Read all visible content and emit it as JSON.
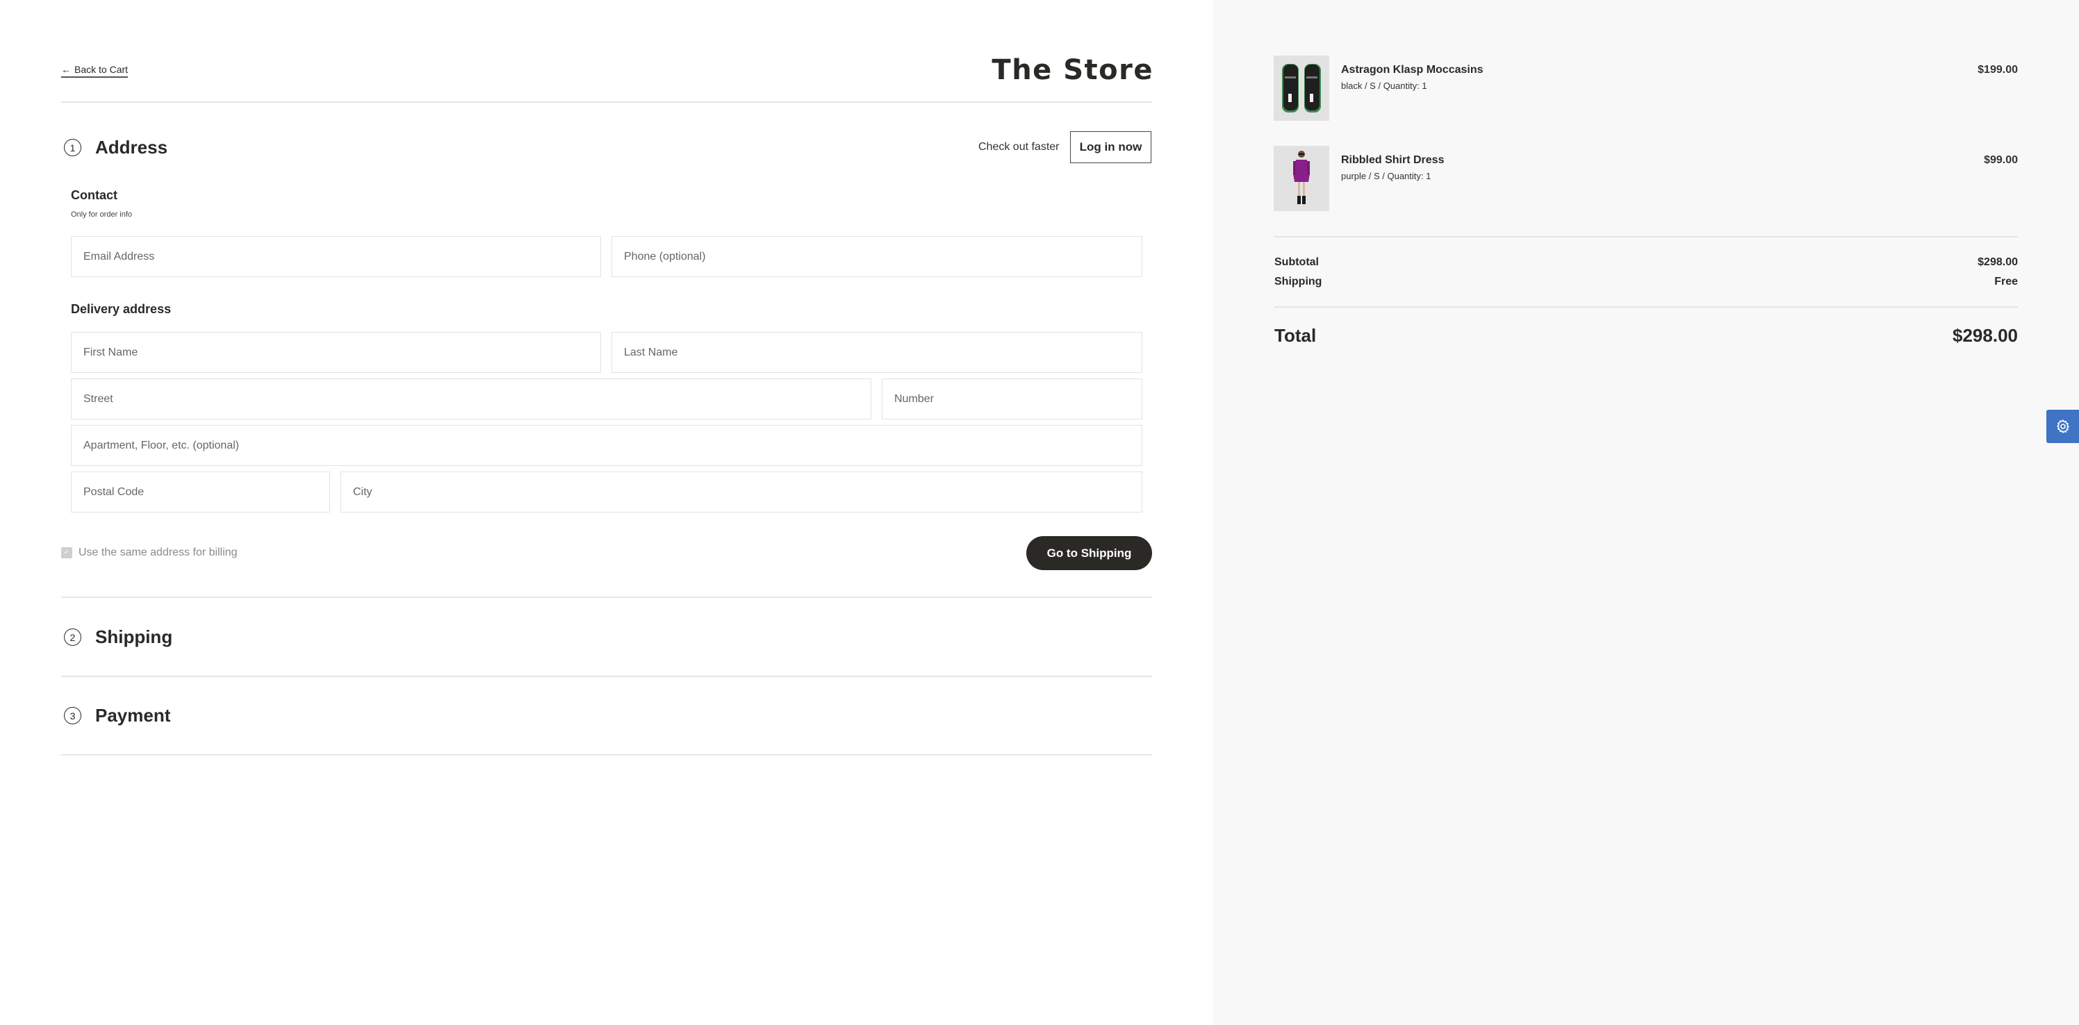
{
  "header": {
    "back_label": "Back to Cart",
    "back_icon": "arrow-left-icon",
    "store_title": "The Store"
  },
  "steps": [
    {
      "number": "1",
      "title": "Address"
    },
    {
      "number": "2",
      "title": "Shipping"
    },
    {
      "number": "3",
      "title": "Payment"
    }
  ],
  "login": {
    "prompt": "Check out faster",
    "button_label": "Log in now"
  },
  "contact": {
    "title": "Contact",
    "subtitle": "Only for order info",
    "email_placeholder": "Email Address",
    "email_value": "",
    "phone_placeholder": "Phone (optional)",
    "phone_value": ""
  },
  "delivery": {
    "title": "Delivery address",
    "first_name_placeholder": "First Name",
    "last_name_placeholder": "Last Name",
    "street_placeholder": "Street",
    "number_placeholder": "Number",
    "apartment_placeholder": "Apartment, Floor, etc. (optional)",
    "postal_placeholder": "Postal Code",
    "city_placeholder": "City"
  },
  "billing": {
    "label": "Use the same address for billing",
    "checked": true
  },
  "actions": {
    "go_to_shipping": "Go to Shipping"
  },
  "summary": {
    "items": [
      {
        "name": "Astragon Klasp Moccasins",
        "variant": "black / S / Quantity: 1",
        "price": "$199.00",
        "image": "black-moccasins-photo"
      },
      {
        "name": "Ribbled Shirt Dress",
        "variant": "purple / S / Quantity: 1",
        "price": "$99.00",
        "image": "purple-dress-photo"
      }
    ],
    "subtotal_label": "Subtotal",
    "subtotal_value": "$298.00",
    "shipping_label": "Shipping",
    "shipping_value": "Free",
    "total_label": "Total",
    "total_value": "$298.00"
  },
  "settings_button": {
    "icon": "gear-icon",
    "color": "#3f73c4"
  }
}
